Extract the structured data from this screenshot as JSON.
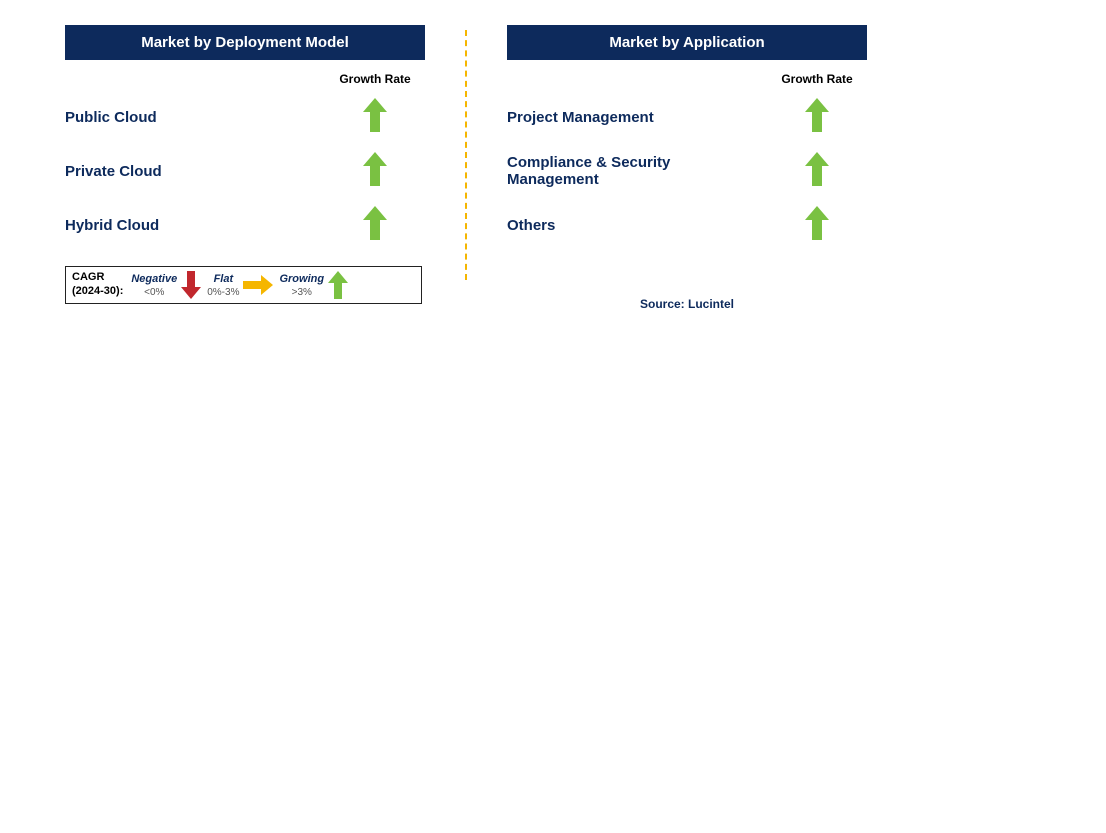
{
  "panels": {
    "left": {
      "title": "Market by Deployment Model",
      "growthHeader": "Growth Rate",
      "rows": [
        {
          "label": "Public Cloud",
          "trend": "growing"
        },
        {
          "label": "Private Cloud",
          "trend": "growing"
        },
        {
          "label": "Hybrid Cloud",
          "trend": "growing"
        }
      ]
    },
    "right": {
      "title": "Market by Application",
      "growthHeader": "Growth Rate",
      "rows": [
        {
          "label": "Project Management",
          "trend": "growing"
        },
        {
          "label": "Compliance & Security Management",
          "trend": "growing"
        },
        {
          "label": "Others",
          "trend": "growing"
        }
      ]
    }
  },
  "legend": {
    "cagr": "CAGR\n(2024-30):",
    "categories": [
      {
        "label": "Negative",
        "range": "<0%",
        "iconColor": "#c1272d",
        "icon": "down"
      },
      {
        "label": "Flat",
        "range": "0%-3%",
        "iconColor": "#f5b600",
        "icon": "right"
      },
      {
        "label": "Growing",
        "range": ">3%",
        "iconColor": "#7ac142",
        "icon": "up"
      }
    ]
  },
  "source": "Source: Lucintel",
  "colors": {
    "headerBg": "#0d2a5c",
    "growArrow": "#7ac142",
    "flatArrow": "#f5b600",
    "downArrow": "#c1272d"
  },
  "chart_data": {
    "type": "table",
    "title": "Market Segment Growth Rates (CAGR 2024-30)",
    "legend_scale": [
      {
        "label": "Negative",
        "range": "<0%"
      },
      {
        "label": "Flat",
        "range": "0%-3%"
      },
      {
        "label": "Growing",
        "range": ">3%"
      }
    ],
    "segments": [
      {
        "name": "Market by Deployment Model",
        "items": [
          {
            "category": "Public Cloud",
            "growth": "Growing",
            "cagr_range": ">3%"
          },
          {
            "category": "Private Cloud",
            "growth": "Growing",
            "cagr_range": ">3%"
          },
          {
            "category": "Hybrid Cloud",
            "growth": "Growing",
            "cagr_range": ">3%"
          }
        ]
      },
      {
        "name": "Market by Application",
        "items": [
          {
            "category": "Project Management",
            "growth": "Growing",
            "cagr_range": ">3%"
          },
          {
            "category": "Compliance & Security Management",
            "growth": "Growing",
            "cagr_range": ">3%"
          },
          {
            "category": "Others",
            "growth": "Growing",
            "cagr_range": ">3%"
          }
        ]
      }
    ],
    "source": "Lucintel"
  }
}
